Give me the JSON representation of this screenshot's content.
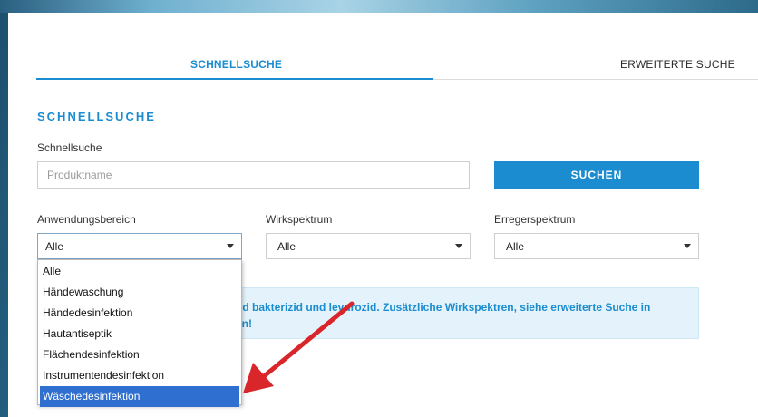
{
  "tabs": [
    {
      "label": "SCHNELLSUCHE",
      "active": true
    },
    {
      "label": "ERWEITERTE SUCHE",
      "active": false
    }
  ],
  "section_title": "SCHNELLSUCHE",
  "search": {
    "label": "Schnellsuche",
    "placeholder": "Produktname",
    "value": "",
    "button_label": "SUCHEN"
  },
  "filters": {
    "anwendungsbereich": {
      "label": "Anwendungsbereich",
      "value": "Alle"
    },
    "wirkspektrum": {
      "label": "Wirkspektrum",
      "value": "Alle"
    },
    "erregerspektrum": {
      "label": "Erregerspektrum",
      "value": "Alle"
    }
  },
  "dropdown_options": [
    "Alle",
    "Händewaschung",
    "Händedesinfektion",
    "Hautantiseptik",
    "Flächendesinfektion",
    "Instrumentendesinfektion",
    "Wäschedesinfektion"
  ],
  "dropdown_highlighted": "Wäschedesinfektion",
  "info": {
    "line1": "nd bakterizid und levurozid. Zusätzliche Wirkspektren, siehe erweiterte Suche in",
    "line2": "en!"
  },
  "colors": {
    "accent": "#1a8ccf",
    "highlight": "#2f6fcf",
    "annotation_arrow": "#d9262a",
    "info_bg": "#e4f3fb"
  }
}
